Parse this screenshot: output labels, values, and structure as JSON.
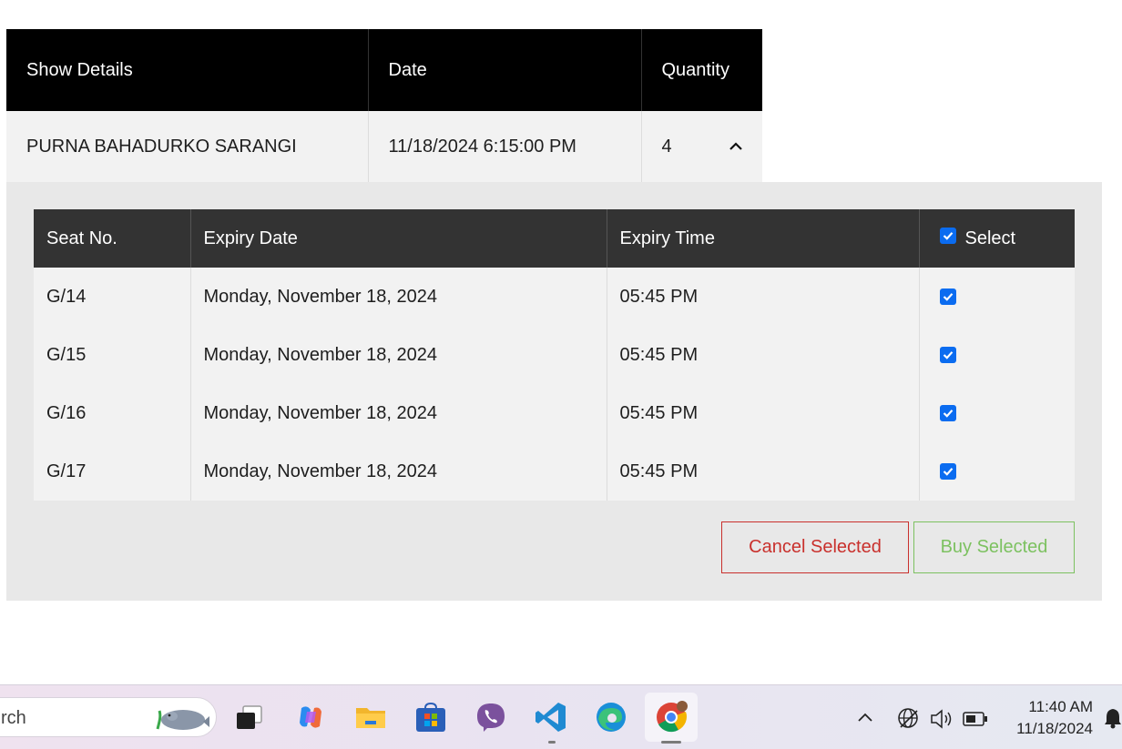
{
  "booking_table": {
    "headers": [
      "Show Details",
      "Date",
      "Quantity"
    ],
    "row": {
      "show": "PURNA BAHADURKO SARANGI",
      "date": "11/18/2024 6:15:00 PM",
      "quantity": "4"
    }
  },
  "seat_table": {
    "headers": {
      "seat": "Seat No.",
      "expiry_date": "Expiry Date",
      "expiry_time": "Expiry Time",
      "select": "Select"
    },
    "select_all_checked": true,
    "rows": [
      {
        "seat": "G/14",
        "expiry_date": "Monday, November 18, 2024",
        "expiry_time": "05:45 PM",
        "selected": true
      },
      {
        "seat": "G/15",
        "expiry_date": "Monday, November 18, 2024",
        "expiry_time": "05:45 PM",
        "selected": true
      },
      {
        "seat": "G/16",
        "expiry_date": "Monday, November 18, 2024",
        "expiry_time": "05:45 PM",
        "selected": true
      },
      {
        "seat": "G/17",
        "expiry_date": "Monday, November 18, 2024",
        "expiry_time": "05:45 PM",
        "selected": true
      }
    ]
  },
  "actions": {
    "cancel_label": "Cancel Selected",
    "buy_label": "Buy Selected"
  },
  "colors": {
    "cancel": "#c9302c",
    "buy": "#7cc160",
    "checkbox": "#0b6cf0"
  },
  "taskbar": {
    "search_text": "rch",
    "apps": [
      "task-view-icon",
      "copilot-icon",
      "file-explorer-icon",
      "microsoft-store-icon",
      "viber-icon",
      "vscode-icon",
      "edge-icon",
      "chrome-icon"
    ],
    "time": "11:40 AM",
    "date": "11/18/2024"
  }
}
